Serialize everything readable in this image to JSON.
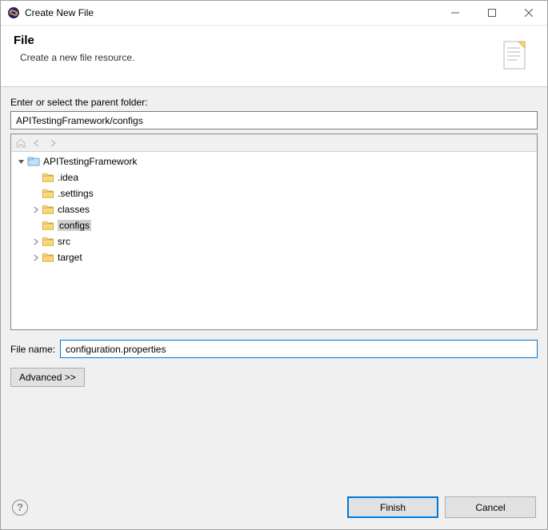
{
  "window": {
    "title": "Create New File"
  },
  "header": {
    "title": "File",
    "description": "Create a new file resource."
  },
  "parentFolder": {
    "label": "Enter or select the parent folder:",
    "value": "APITestingFramework/configs"
  },
  "tree": {
    "root": {
      "label": "APITestingFramework",
      "expanded": true,
      "children": [
        {
          "label": ".idea",
          "hasChildren": false
        },
        {
          "label": ".settings",
          "hasChildren": false
        },
        {
          "label": "classes",
          "hasChildren": true
        },
        {
          "label": "configs",
          "hasChildren": false,
          "selected": true
        },
        {
          "label": "src",
          "hasChildren": true
        },
        {
          "label": "target",
          "hasChildren": true
        }
      ]
    }
  },
  "fileName": {
    "label": "File name:",
    "value": "configuration.properties"
  },
  "buttons": {
    "advanced": "Advanced >>",
    "finish": "Finish",
    "cancel": "Cancel"
  }
}
